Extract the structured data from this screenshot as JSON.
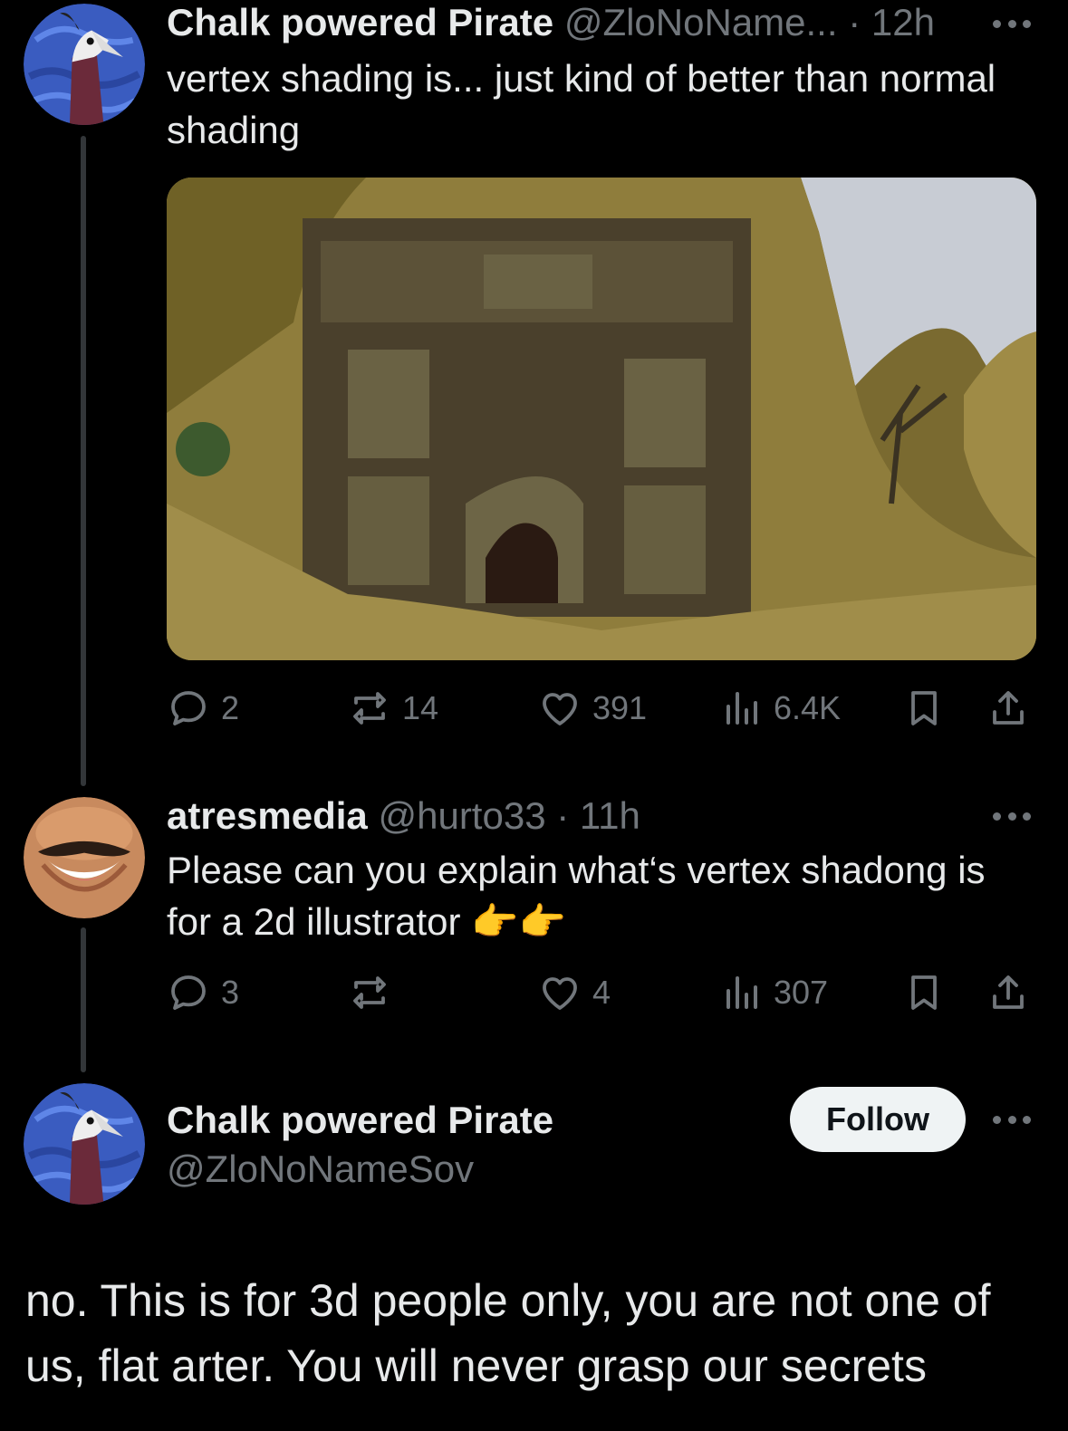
{
  "post1": {
    "name": "Chalk powered Pirate",
    "handle": "@ZloNoName...",
    "separator": "·",
    "time": "12h",
    "text": "vertex shading is... just kind of better than normal shading",
    "media_alt": "stone gate built into a sandy cliff, low-poly game scene",
    "actions": {
      "replies": "2",
      "reposts": "14",
      "likes": "391",
      "views": "6.4K"
    }
  },
  "post2": {
    "name": "atresmedia",
    "handle": "@hurto33",
    "separator": "·",
    "time": "11h",
    "text": "Please can you explain what‘s vertex shadong is for a 2d illustrator 👉👉",
    "actions": {
      "replies": "3",
      "reposts": "",
      "likes": "4",
      "views": "307"
    }
  },
  "post3": {
    "name": "Chalk powered Pirate",
    "handle": "@ZloNoNameSov",
    "follow_label": "Follow",
    "text": "no. This is for 3d people only, you are not one of us, flat arter. You will never grasp our secrets"
  },
  "icons": {
    "reply": "reply-icon",
    "repost": "repost-icon",
    "like": "heart-icon",
    "views": "views-chart-icon",
    "bookmark": "bookmark-icon",
    "share": "share-icon",
    "more": "more-dots-icon"
  },
  "colors": {
    "background": "#000000",
    "text": "#e7e9ea",
    "muted": "#71767b",
    "thread": "#333639",
    "button": "#eff3f4"
  }
}
